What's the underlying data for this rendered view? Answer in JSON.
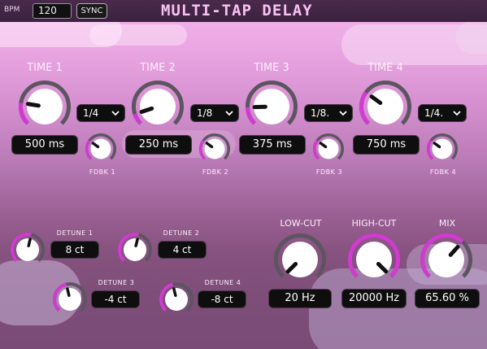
{
  "header": {
    "bpm_label": "BPM",
    "bpm_value": "120",
    "sync_label": "SYNC",
    "title": "MULTI-TAP DELAY"
  },
  "taps": [
    {
      "time_label": "TIME 1",
      "time_value": "500 ms",
      "division": "1/4",
      "fdbk_label": "FDBK 1"
    },
    {
      "time_label": "TIME 2",
      "time_value": "250 ms",
      "division": "1/8",
      "fdbk_label": "FDBK 2"
    },
    {
      "time_label": "TIME 3",
      "time_value": "375 ms",
      "division": "1/8.",
      "fdbk_label": "FDBK 3"
    },
    {
      "time_label": "TIME 4",
      "time_value": "750 ms",
      "division": "1/4.",
      "fdbk_label": "FDBK 4"
    }
  ],
  "detune": [
    {
      "label": "DETUNE 1",
      "value": "8 ct"
    },
    {
      "label": "DETUNE 2",
      "value": "4 ct"
    },
    {
      "label": "DETUNE 3",
      "value": "-4 ct"
    },
    {
      "label": "DETUNE 4",
      "value": "-8 ct"
    }
  ],
  "filters": {
    "low_cut_label": "LOW-CUT",
    "low_cut_value": "20 Hz",
    "high_cut_label": "HIGH-CUT",
    "high_cut_value": "20000 Hz",
    "mix_label": "MIX",
    "mix_value": "65.60 %"
  },
  "colors": {
    "accent": "#d23ad2",
    "track": "#5c5560",
    "knob_face": "#ffffff",
    "pointer": "#111111",
    "display_bg": "#0e0e0e"
  },
  "knob_levels": {
    "time_1": 0.2,
    "time_2": 0.1,
    "time_3": 0.16,
    "time_4": 0.3,
    "fdbk_1": 0.3,
    "fdbk_2": 0.3,
    "fdbk_3": 0.3,
    "fdbk_4": 0.3,
    "detune_1": 0.55,
    "detune_2": 0.55,
    "detune_3": 0.45,
    "detune_4": 0.45,
    "low_cut": 0.0,
    "high_cut": 1.0,
    "mix": 0.656
  },
  "icons": {
    "dropdown": "chevron-down-icon",
    "knob": "rotary-knob"
  }
}
